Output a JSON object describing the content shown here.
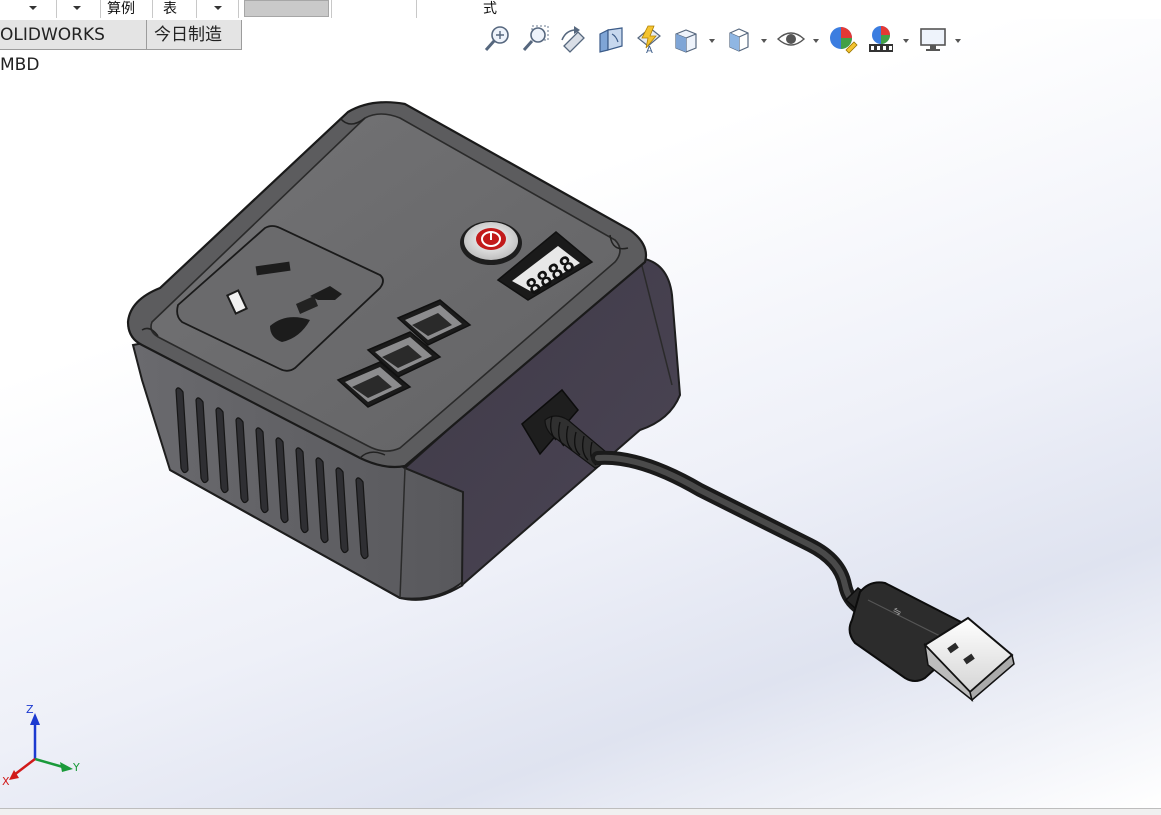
{
  "top_strip": {
    "labels": [
      "算例",
      "表",
      "式"
    ]
  },
  "tabs": [
    {
      "label": "OLIDWORKS MBD"
    },
    {
      "label": "今日制造"
    }
  ],
  "toolbar": {
    "icons": [
      "zoom-to-fit-icon",
      "zoom-to-area-icon",
      "previous-view-icon",
      "section-view-icon",
      "dynamic-annotation-icon",
      "view-orientation-icon",
      "display-style-icon",
      "hide-show-icon",
      "edit-appearance-icon",
      "apply-scene-icon",
      "view-settings-icon"
    ]
  },
  "model": {
    "display_text": "8888",
    "body_color": "#4a4650",
    "top_color": "#6c6c6e"
  },
  "triad": {
    "x_label": "X",
    "y_label": "Y",
    "z_label": "Z",
    "x_color": "#d11a1a",
    "y_color": "#1a9a3a",
    "z_color": "#1c3ad0"
  }
}
